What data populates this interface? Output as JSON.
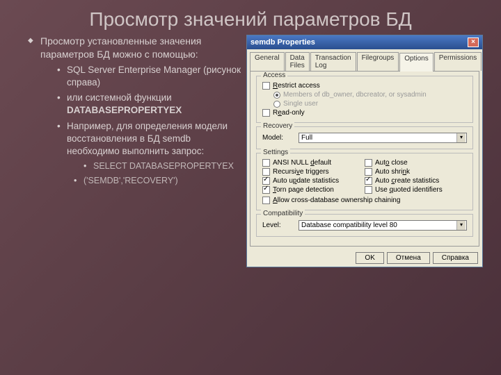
{
  "title": "Просмотр значений параметров БД",
  "bullets": {
    "main": "Просмотр установленные значения параметров БД можно с помощью:",
    "sub1": "SQL Server Enterprise Manager (рисунок справа)",
    "sub2_prefix": "или системной функции ",
    "sub2_bold": "DATABASEPROPERTYEX",
    "sub3": "Например, для определения модели восстановления в БД semdb необходимо выполнить запрос:",
    "code1": "SELECT DATABASEPROPERTYEX",
    "code2": "('SEMDB','RECOVERY')"
  },
  "dialog": {
    "title": "semdb Properties",
    "tabs": [
      "General",
      "Data Files",
      "Transaction Log",
      "Filegroups",
      "Options",
      "Permissions"
    ],
    "active_tab": "Options",
    "groups": {
      "access": {
        "title": "Access",
        "restrict": "Restrict access",
        "members": "Members of db_owner, dbcreator, or sysadmin",
        "single": "Single user",
        "readonly": "Read-only"
      },
      "recovery": {
        "title": "Recovery",
        "model_label": "Model:",
        "model_value": "Full"
      },
      "settings": {
        "title": "Settings",
        "ansi_null": "ANSI NULL default",
        "recursive": "Recursive triggers",
        "auto_update": "Auto update statistics",
        "torn_page": "Torn page detection",
        "auto_close": "Auto close",
        "auto_shrink": "Auto shrink",
        "auto_create": "Auto create statistics",
        "quoted": "Use quoted identifiers",
        "allow_cross": "Allow cross-database ownership chaining"
      },
      "compat": {
        "title": "Compatibility",
        "level_label": "Level:",
        "level_value": "Database compatibility level 80"
      }
    },
    "buttons": {
      "ok": "OK",
      "cancel": "Отмена",
      "help": "Справка"
    }
  }
}
